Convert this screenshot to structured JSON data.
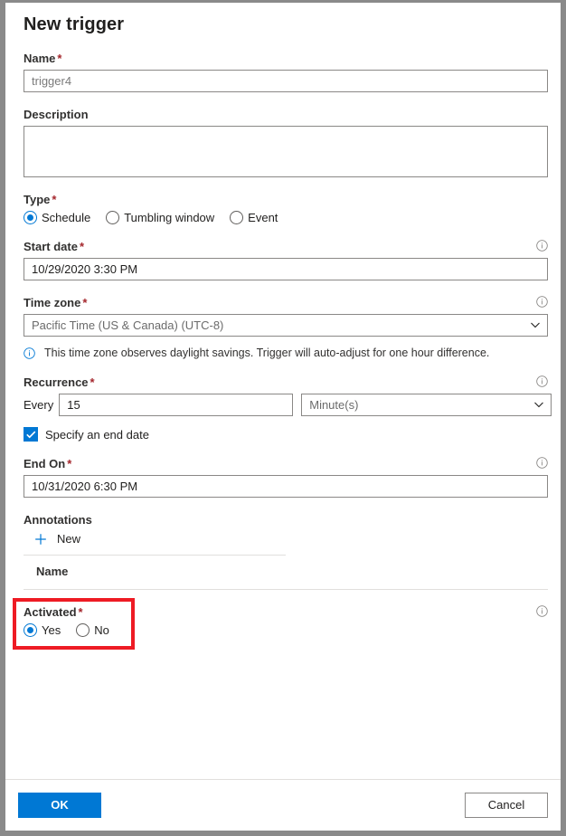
{
  "panel": {
    "title": "New trigger"
  },
  "fields": {
    "name": {
      "label": "Name",
      "required": "*",
      "value": "trigger4"
    },
    "description": {
      "label": "Description",
      "value": ""
    },
    "type": {
      "label": "Type",
      "required": "*",
      "options": [
        {
          "label": "Schedule",
          "selected": true
        },
        {
          "label": "Tumbling window",
          "selected": false
        },
        {
          "label": "Event",
          "selected": false
        }
      ]
    },
    "start_date": {
      "label": "Start date",
      "required": "*",
      "value": "10/29/2020 3:30 PM"
    },
    "time_zone": {
      "label": "Time zone",
      "required": "*",
      "value": "Pacific Time (US & Canada) (UTC-8)",
      "note": "This time zone observes daylight savings. Trigger will auto-adjust for one hour difference."
    },
    "recurrence": {
      "label": "Recurrence",
      "required": "*",
      "every_label": "Every",
      "interval": "15",
      "unit": "Minute(s)"
    },
    "specify_end_date": {
      "label": "Specify an end date",
      "checked": true
    },
    "end_on": {
      "label": "End On",
      "required": "*",
      "value": "10/31/2020 6:30 PM"
    },
    "annotations": {
      "label": "Annotations",
      "new_label": "New",
      "column_header": "Name",
      "rows": []
    },
    "activated": {
      "label": "Activated",
      "required": "*",
      "options": [
        {
          "label": "Yes",
          "selected": true
        },
        {
          "label": "No",
          "selected": false
        }
      ]
    }
  },
  "footer": {
    "ok_label": "OK",
    "cancel_label": "Cancel"
  },
  "colors": {
    "accent": "#0078d4",
    "required_asterisk": "#a4262c",
    "highlight_box": "#ee1b24",
    "window_border": "#8a8a8a"
  },
  "icons": {
    "info": "info-circle-icon",
    "chevron": "chevron-down-icon",
    "plus": "plus-icon",
    "check": "check-icon"
  }
}
